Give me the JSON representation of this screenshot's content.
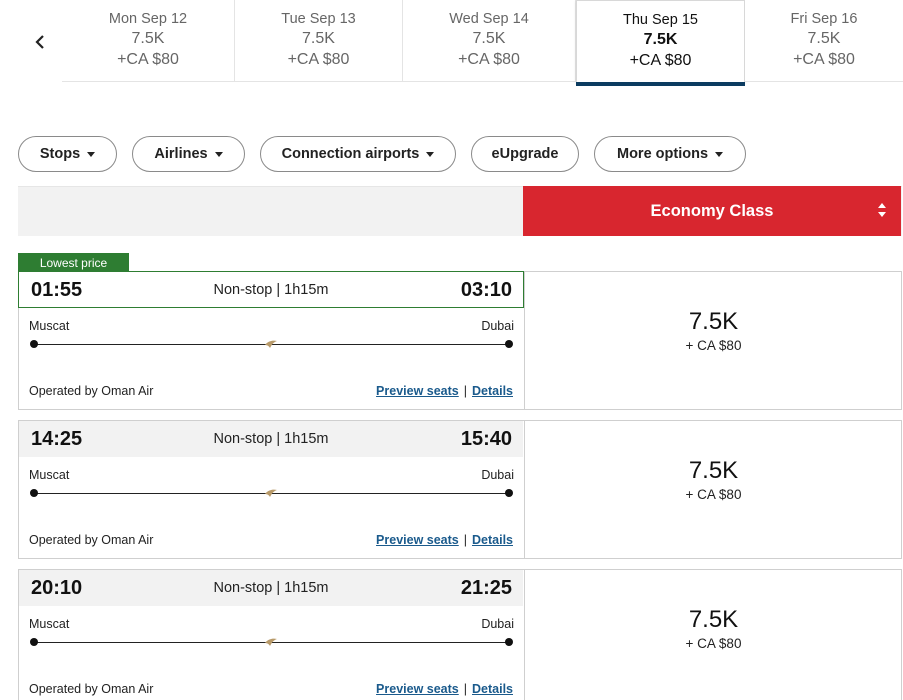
{
  "date_strip": {
    "prev_icon": "chevron-left-icon",
    "dates": [
      {
        "day": "Mon Sep 12",
        "miles": "7.5K",
        "tax": "+CA $80",
        "selected": false
      },
      {
        "day": "Tue Sep 13",
        "miles": "7.5K",
        "tax": "+CA $80",
        "selected": false
      },
      {
        "day": "Wed Sep 14",
        "miles": "7.5K",
        "tax": "+CA $80",
        "selected": false
      },
      {
        "day": "Thu Sep 15",
        "miles": "7.5K",
        "tax": "+CA $80",
        "selected": true
      },
      {
        "day": "Fri Sep 16",
        "miles": "7.5K",
        "tax": "+CA $80",
        "selected": false
      }
    ]
  },
  "filters": {
    "stops": "Stops",
    "airlines": "Airlines",
    "connection_airports": "Connection airports",
    "eupgrade": "eUpgrade",
    "more_options": "More options"
  },
  "cabin": {
    "label": "Economy Class",
    "color": "#d8262f"
  },
  "badge": {
    "lowest_price": "Lowest price",
    "color": "#2e7d32"
  },
  "flights": [
    {
      "depart": "01:55",
      "arrive": "03:10",
      "duration": "Non-stop | 1h15m",
      "origin": "Muscat",
      "destination": "Dubai",
      "operated_by": "Operated by Oman Air",
      "preview_seats": "Preview seats",
      "details": "Details",
      "separator": "|",
      "miles": "7.5K",
      "tax": "+ CA $80"
    },
    {
      "depart": "14:25",
      "arrive": "15:40",
      "duration": "Non-stop | 1h15m",
      "origin": "Muscat",
      "destination": "Dubai",
      "operated_by": "Operated by Oman Air",
      "preview_seats": "Preview seats",
      "details": "Details",
      "separator": "|",
      "miles": "7.5K",
      "tax": "+ CA $80"
    },
    {
      "depart": "20:10",
      "arrive": "21:25",
      "duration": "Non-stop | 1h15m",
      "origin": "Muscat",
      "destination": "Dubai",
      "operated_by": "Operated by Oman Air",
      "preview_seats": "Preview seats",
      "details": "Details",
      "separator": "|",
      "miles": "7.5K",
      "tax": "+ CA $80"
    }
  ]
}
